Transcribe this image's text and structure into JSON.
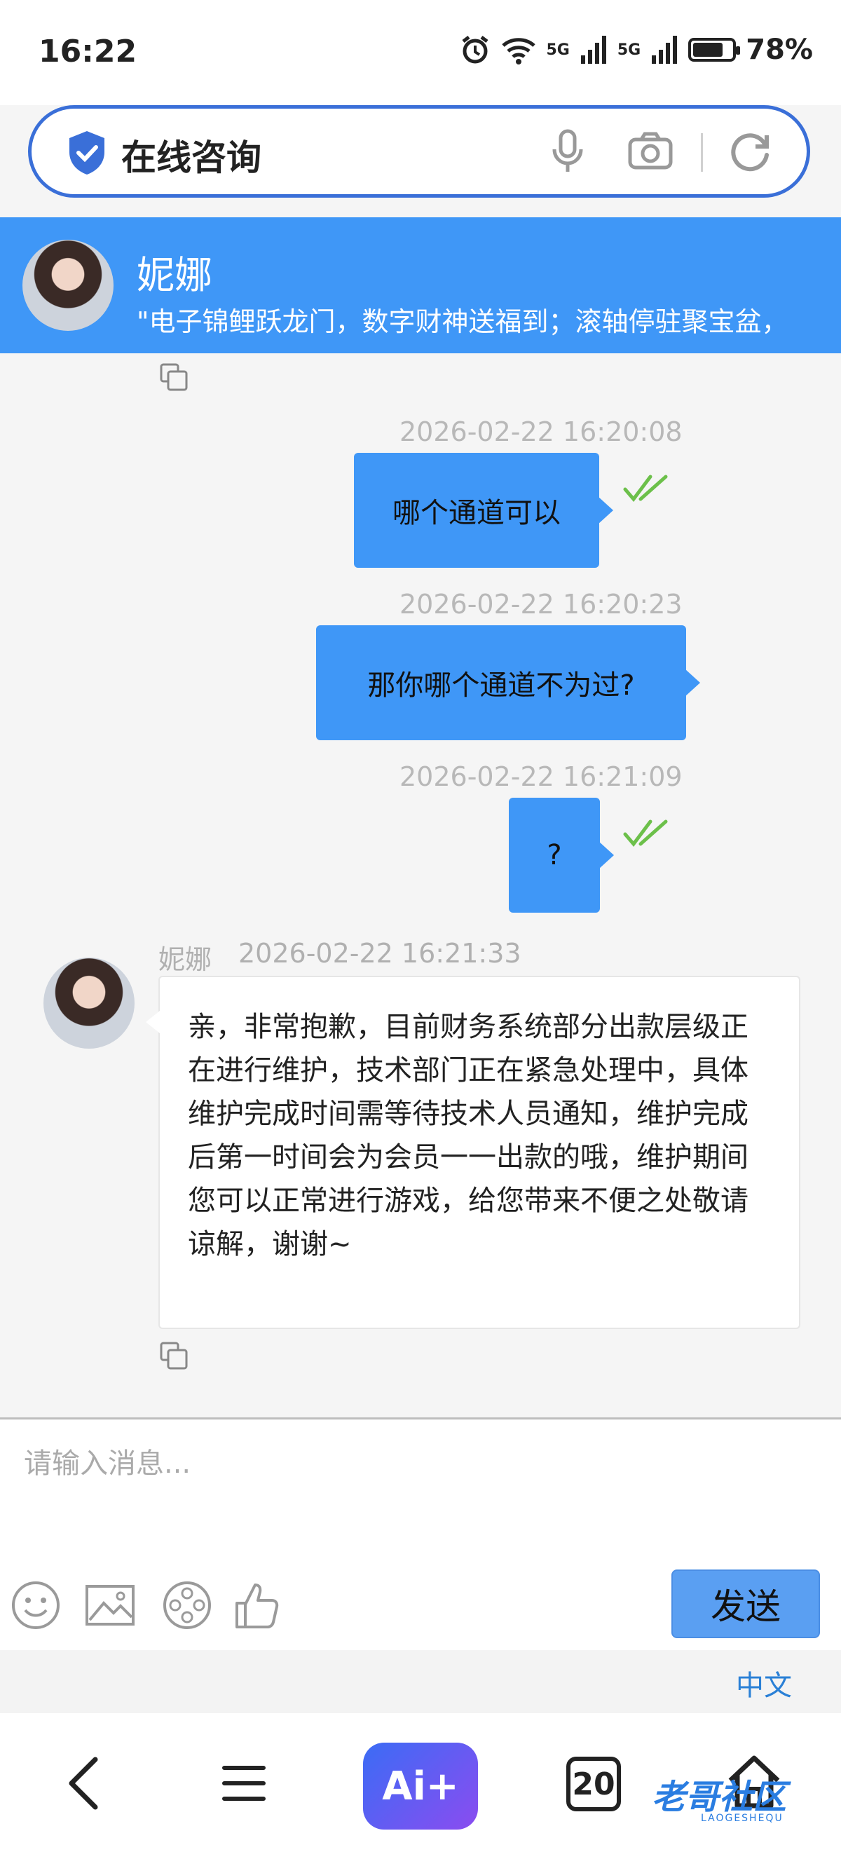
{
  "status": {
    "time": "16:22",
    "network1": "5G",
    "network2": "5G",
    "battery": "78%",
    "battery_level": 0.78
  },
  "search": {
    "title": "在线咨询"
  },
  "header": {
    "name": "妮娜",
    "marquee": "\"电子锦鲤跃龙门，数字财神送福到；滚轴停驻聚宝盆，"
  },
  "messages": [
    {
      "side": "out",
      "time": "2026-02-22 16:20:08",
      "text": "哪个通道可以",
      "read": true
    },
    {
      "side": "out",
      "time": "2026-02-22 16:20:23",
      "text": "那你哪个通道不为过?",
      "read": false
    },
    {
      "side": "out",
      "time": "2026-02-22 16:21:09",
      "text": "?",
      "read": true
    },
    {
      "side": "in",
      "name": "妮娜",
      "time": "2026-02-22 16:21:33",
      "text": "亲，非常抱歉，目前财务系统部分出款层级正在进行维护，技术部门正在紧急处理中，具体维护完成时间需等待技术人员通知，维护完成后第一时间会为会员一一出款的哦，维护期间您可以正常进行游戏，给您带来不便之处敬请谅解，谢谢~"
    }
  ],
  "composer": {
    "placeholder": "请输入消息...",
    "send_label": "发送",
    "language": "中文"
  },
  "nav": {
    "ai_label": "Ai+",
    "tab_count": "20",
    "watermark": "老哥社区",
    "watermark_sub": "LAOGESHEQU"
  },
  "icons": {
    "status": [
      "alarm-icon",
      "wifi-icon",
      "signal-icon",
      "signal-icon",
      "battery-icon"
    ],
    "search": [
      "shield-check-icon",
      "microphone-icon",
      "camera-icon",
      "refresh-icon"
    ],
    "tools": [
      "emoji-icon",
      "image-icon",
      "video-reel-icon",
      "thumbs-up-icon"
    ],
    "nav": [
      "back-icon",
      "menu-icon",
      "ai-icon",
      "tabs-icon",
      "home-icon"
    ]
  },
  "colors": {
    "accent": "#3f97f7",
    "search_border": "#3a6fd8",
    "read_check": "#6cc04a",
    "language_link": "#2a80d6"
  }
}
